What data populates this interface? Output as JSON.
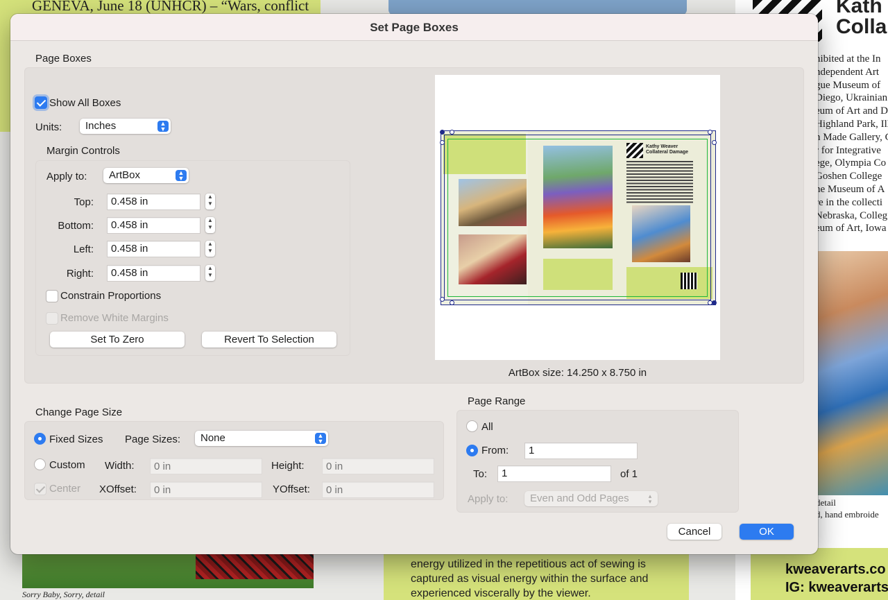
{
  "background": {
    "headline": "GENEVA, June 18 (UNHCR) – “Wars, conflict",
    "right_title_lines": [
      "Kath",
      "Colla"
    ],
    "right_text_lines": [
      "hibited at the In",
      "ndependent Art",
      "gue Museum of",
      "Diego, Ukrainian",
      "eum of Art and D",
      "Highland Park, Ill",
      "n Made Gallery, C",
      "r for Integrative",
      "ege, Olympia Co",
      "Goshen College",
      "he Museum of A",
      "re in the collecti",
      "Nebraska, Colleg",
      "eum of Art, Iowa"
    ],
    "right_caption_lines": [
      "detail",
      "d, hand embroide"
    ],
    "right_contact_lines": [
      "kweaverarts.co",
      "IG: kweaverarts"
    ],
    "left_caption": "Sorry Baby, Sorry, detail",
    "center_text_lines": [
      "energy utilized in the repetitious act of sewing is",
      "captured as visual energy within the surface and",
      "experienced viscerally by the viewer."
    ]
  },
  "dialog": {
    "title": "Set Page Boxes",
    "page_boxes": {
      "section_title": "Page Boxes",
      "show_all_boxes": {
        "label": "Show All Boxes",
        "checked": true
      },
      "units": {
        "label": "Units:",
        "value": "Inches"
      },
      "margin_controls": {
        "title": "Margin Controls",
        "apply_to": {
          "label": "Apply to:",
          "value": "ArtBox"
        },
        "fields": [
          {
            "label": "Top:",
            "value": "0.458 in"
          },
          {
            "label": "Bottom:",
            "value": "0.458 in"
          },
          {
            "label": "Left:",
            "value": "0.458 in"
          },
          {
            "label": "Right:",
            "value": "0.458 in"
          }
        ],
        "constrain_proportions": {
          "label": "Constrain Proportions",
          "checked": false
        },
        "remove_white_margins": {
          "label": "Remove White Margins",
          "checked": false,
          "enabled": false
        },
        "set_to_zero": "Set To Zero",
        "revert_to_selection": "Revert To Selection"
      },
      "preview": {
        "size_label": "ArtBox size: 14.250 x 8.750 in",
        "mini_header_line1": "Kathy Weaver",
        "mini_header_line2": "Collateral Damage",
        "box_colors": {
          "art": "#1f2a8a",
          "trim": "#1fb83a",
          "bleed": "#1f2a8a"
        }
      }
    },
    "change_page_size": {
      "section_title": "Change Page Size",
      "fixed_sizes": {
        "label": "Fixed Sizes",
        "selected": true
      },
      "page_sizes": {
        "label": "Page Sizes:",
        "value": "None"
      },
      "custom": {
        "label": "Custom",
        "selected": false
      },
      "width": {
        "label": "Width:",
        "placeholder": "0 in"
      },
      "height": {
        "label": "Height:",
        "placeholder": "0 in"
      },
      "center": {
        "label": "Center",
        "checked": true,
        "enabled": false
      },
      "xoffset": {
        "label": "XOffset:",
        "placeholder": "0 in"
      },
      "yoffset": {
        "label": "YOffset:",
        "placeholder": "0 in"
      }
    },
    "page_range": {
      "section_title": "Page Range",
      "all": {
        "label": "All",
        "selected": false
      },
      "from": {
        "label": "From:",
        "value": "1",
        "selected": true
      },
      "to": {
        "label": "To:",
        "value": "1"
      },
      "of_total": "of 1",
      "apply_to": {
        "label": "Apply to:",
        "value": "Even and Odd Pages",
        "enabled": false
      }
    },
    "buttons": {
      "cancel": "Cancel",
      "ok": "OK"
    }
  },
  "colors": {
    "accent": "#2d7bf0",
    "dialog_bg": "#ece8e5",
    "group_bg": "#e3dfdc",
    "lime": "#d5e27b"
  },
  "icons": {
    "checkbox_checked": "checkmark-icon",
    "popup_arrows": "updown-chevron-icon",
    "stepper": "stepper-arrows-icon"
  }
}
